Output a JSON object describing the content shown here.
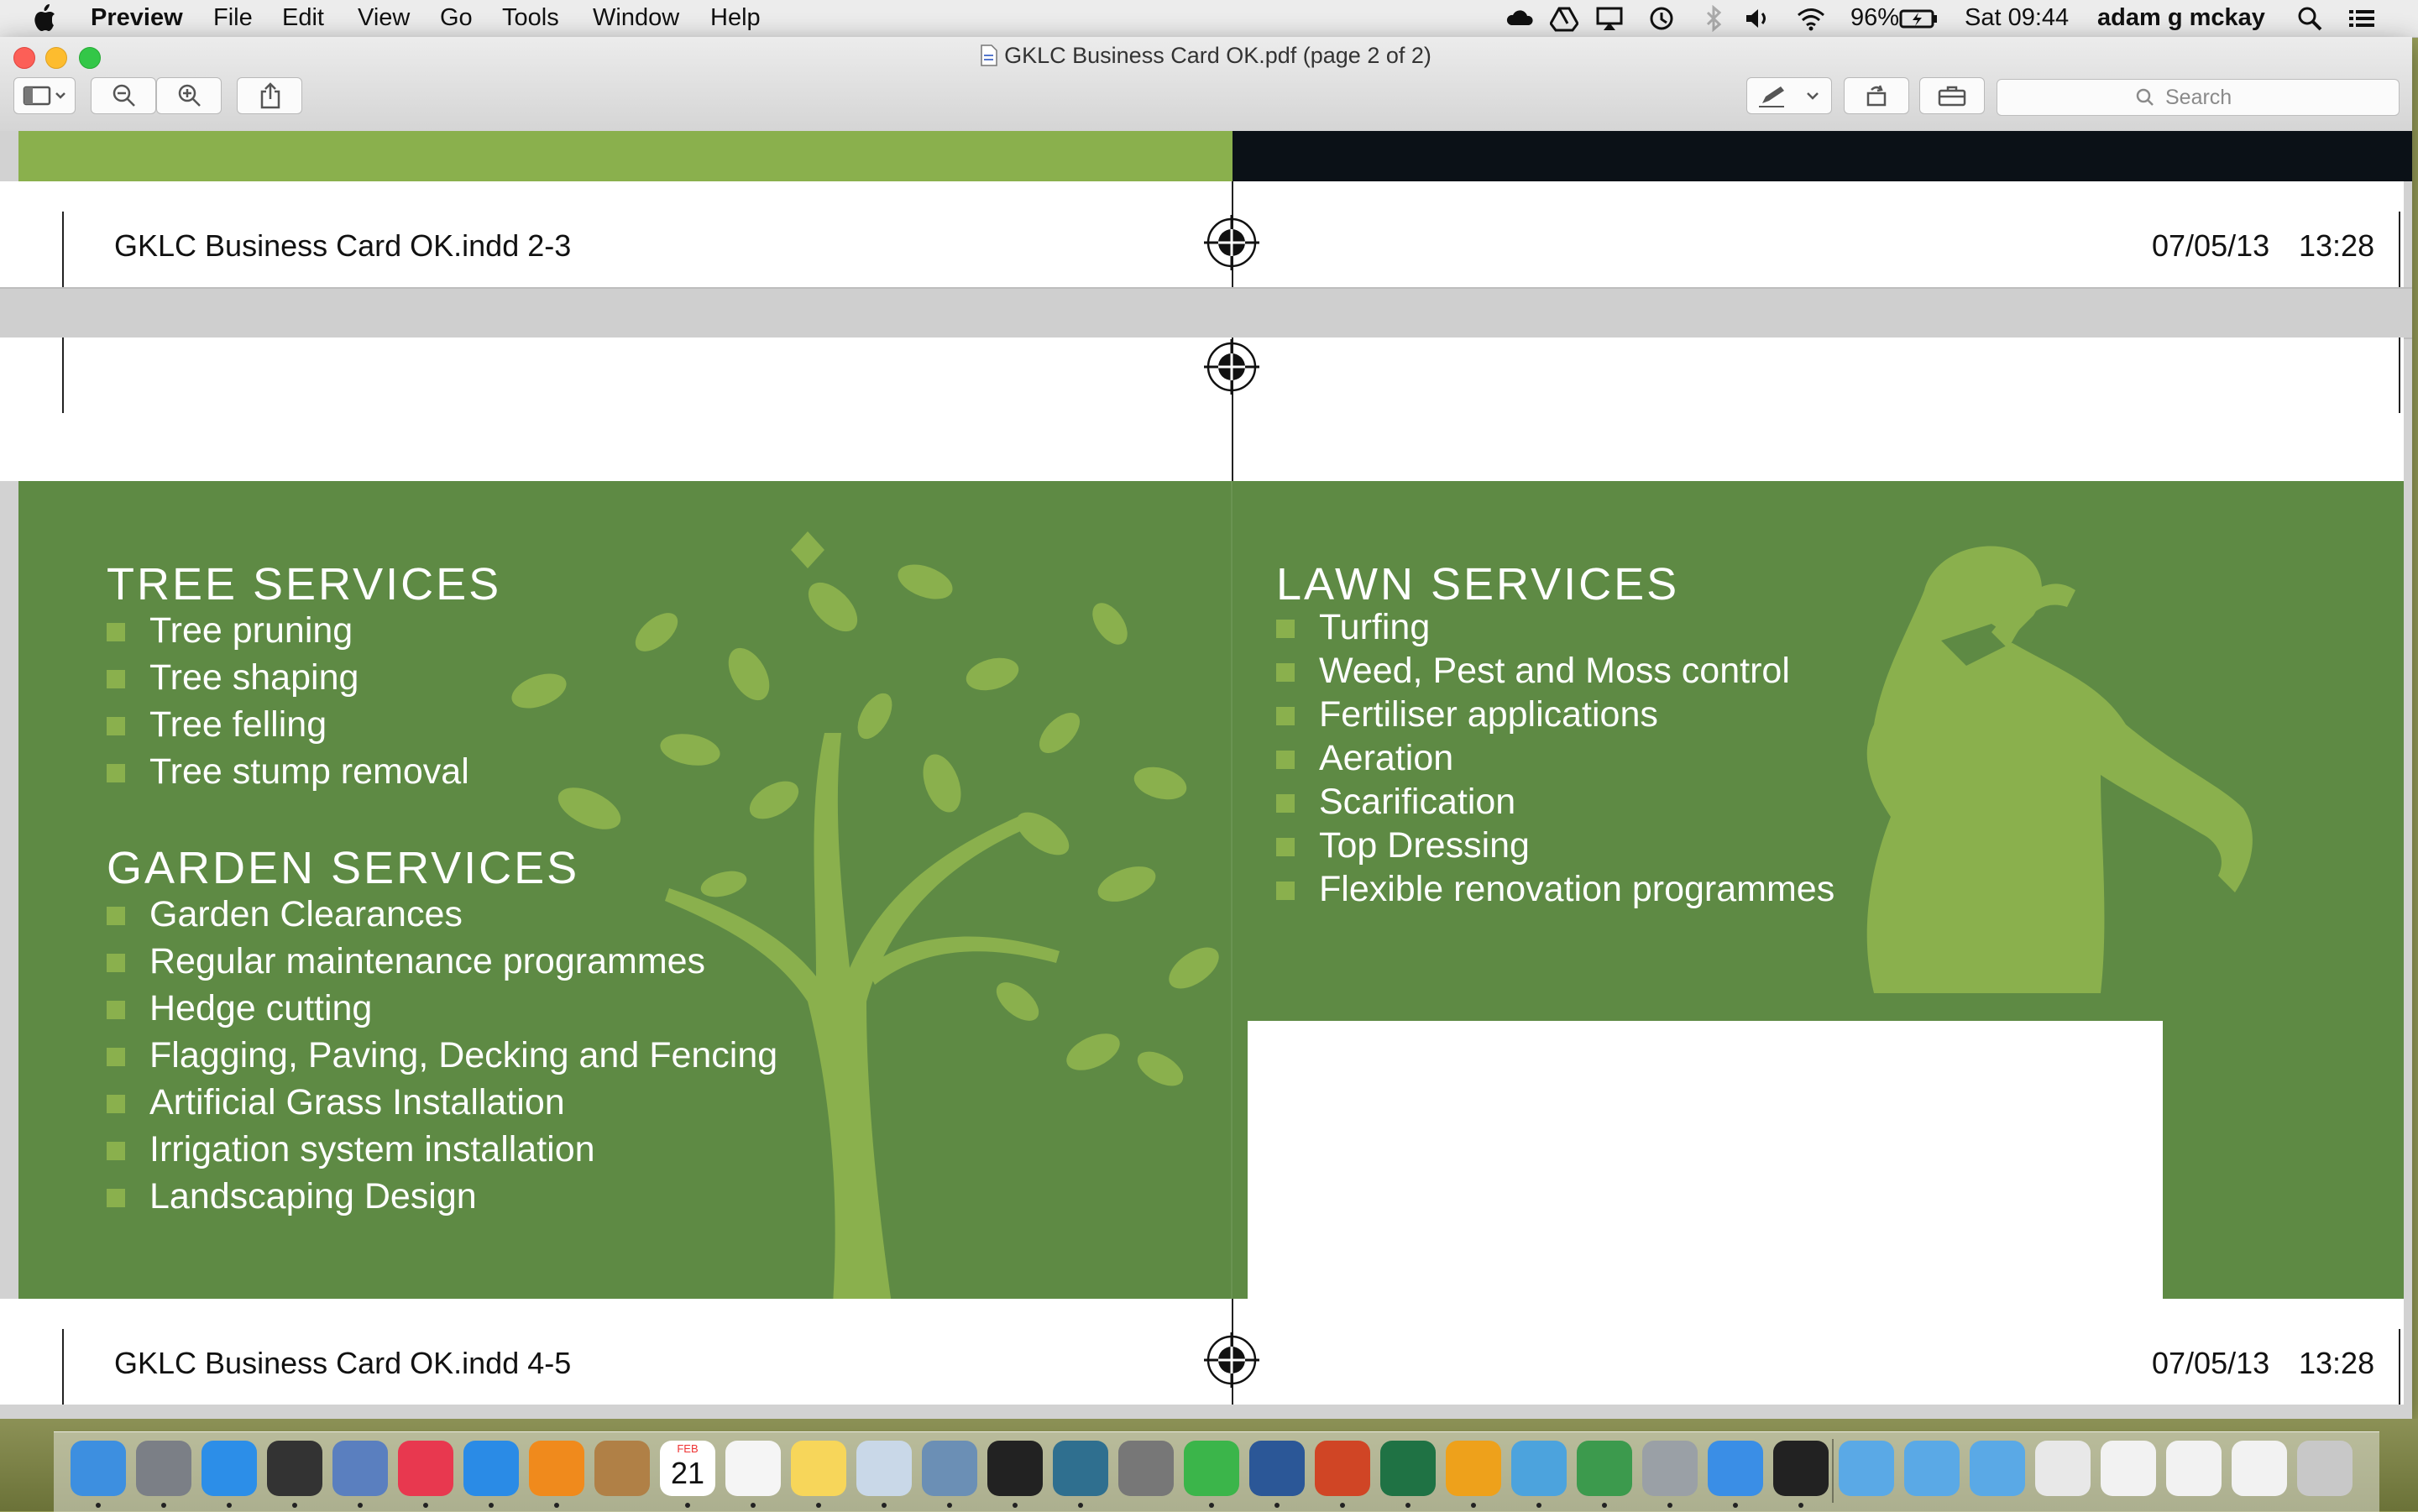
{
  "menubar": {
    "app_name": "Preview",
    "menus": [
      "File",
      "Edit",
      "View",
      "Go",
      "Tools",
      "Window",
      "Help"
    ],
    "battery": "96%",
    "clock": "Sat 09:44",
    "user": "adam g mckay"
  },
  "window": {
    "title": "GKLC Business Card OK.pdf (page 2 of 2)",
    "search_placeholder": "Search"
  },
  "document": {
    "slug_top": {
      "filename": "GKLC Business Card OK.indd   2-3",
      "date": "07/05/13",
      "time": "13:28"
    },
    "slug_bottom": {
      "filename": "GKLC Business Card OK.indd   4-5",
      "date": "07/05/13",
      "time": "13:28"
    },
    "colors": {
      "green_dark": "#5e8a44",
      "green_light": "#8ab04d",
      "black_band": "#0b1117"
    },
    "card": {
      "tree": {
        "heading": "TREE SERVICES",
        "items": [
          "Tree pruning",
          "Tree shaping",
          "Tree felling",
          "Tree stump removal"
        ]
      },
      "garden": {
        "heading": "GARDEN SERVICES",
        "items": [
          "Garden Clearances",
          "Regular maintenance programmes",
          "Hedge cutting",
          "Flagging, Paving, Decking and Fencing",
          "Artificial Grass Installation",
          "Irrigation system installation",
          "Landscaping Design"
        ]
      },
      "lawn": {
        "heading": "LAWN SERVICES",
        "items": [
          "Turfing",
          "Weed, Pest and Moss control",
          "Fertiliser applications",
          "Aeration",
          "Scarification",
          "Top Dressing",
          "Flexible renovation programmes"
        ]
      }
    }
  },
  "dock": {
    "icons": [
      "finder-icon",
      "launchpad-icon",
      "app-store-icon",
      "dashboard-icon",
      "mail-icon",
      "itunes-icon",
      "safari-icon",
      "ibooks-icon",
      "contacts-icon",
      "calendar-icon",
      "reminders-icon",
      "notes-icon",
      "preview-icon",
      "photos-icon",
      "activity-monitor-icon",
      "time-machine-icon",
      "system-preferences-icon",
      "facetime-icon",
      "word-icon",
      "powerpoint-icon",
      "excel-icon",
      "outlook-icon",
      "lync-icon",
      "network-icon",
      "image-capture-icon",
      "messages-icon",
      "dvd-player-icon",
      "folder-icon",
      "applications-folder-icon",
      "documents-folder-icon",
      "document-icon",
      "screenshot-icon",
      "screenshot-icon-2",
      "screenshot-icon-3",
      "trash-icon"
    ],
    "calendar": {
      "month": "FEB",
      "day": "21"
    }
  }
}
